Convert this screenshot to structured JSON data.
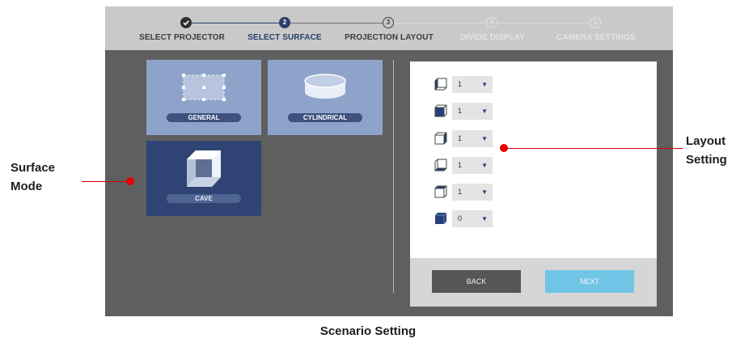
{
  "steps": [
    {
      "number": "",
      "label": "SELECT PROJECTOR",
      "state": "done"
    },
    {
      "number": "2",
      "label": "SELECT SURFACE",
      "state": "active"
    },
    {
      "number": "3",
      "label": "PROJECTION LAYOUT",
      "state": "next"
    },
    {
      "number": "4",
      "label": "DIVIDE DISPLAY",
      "state": "disabled"
    },
    {
      "number": "5",
      "label": "CAMERA SETTINGS",
      "state": "disabled"
    }
  ],
  "surfaces": [
    {
      "label": "GENERAL",
      "icon": "grid-rectangle-icon"
    },
    {
      "label": "CYLINDRICAL",
      "icon": "cylinder-icon"
    },
    {
      "label": "CAVE",
      "icon": "cube-cave-icon",
      "selected": true
    }
  ],
  "layout_rows": [
    {
      "icon": "cube-left-face-icon",
      "value": "1"
    },
    {
      "icon": "cube-front-face-icon",
      "value": "1"
    },
    {
      "icon": "cube-right-face-icon",
      "value": "1"
    },
    {
      "icon": "cube-bottom-face-icon",
      "value": "1"
    },
    {
      "icon": "cube-top-face-icon",
      "value": "1"
    },
    {
      "icon": "cube-floor-face-icon",
      "value": "0"
    }
  ],
  "buttons": {
    "back": "BACK",
    "next": "NEXT"
  },
  "annotations": {
    "surface_mode": [
      "Surface",
      "Mode"
    ],
    "layout_setting": [
      "Layout",
      "Setting"
    ],
    "caption": "Scenario Setting"
  },
  "colors": {
    "accent": "#273f6b",
    "tile_light": "#8ea3c9",
    "tile_dark": "#2f4474",
    "next_button": "#70c4e6",
    "marker": "#e30000"
  }
}
